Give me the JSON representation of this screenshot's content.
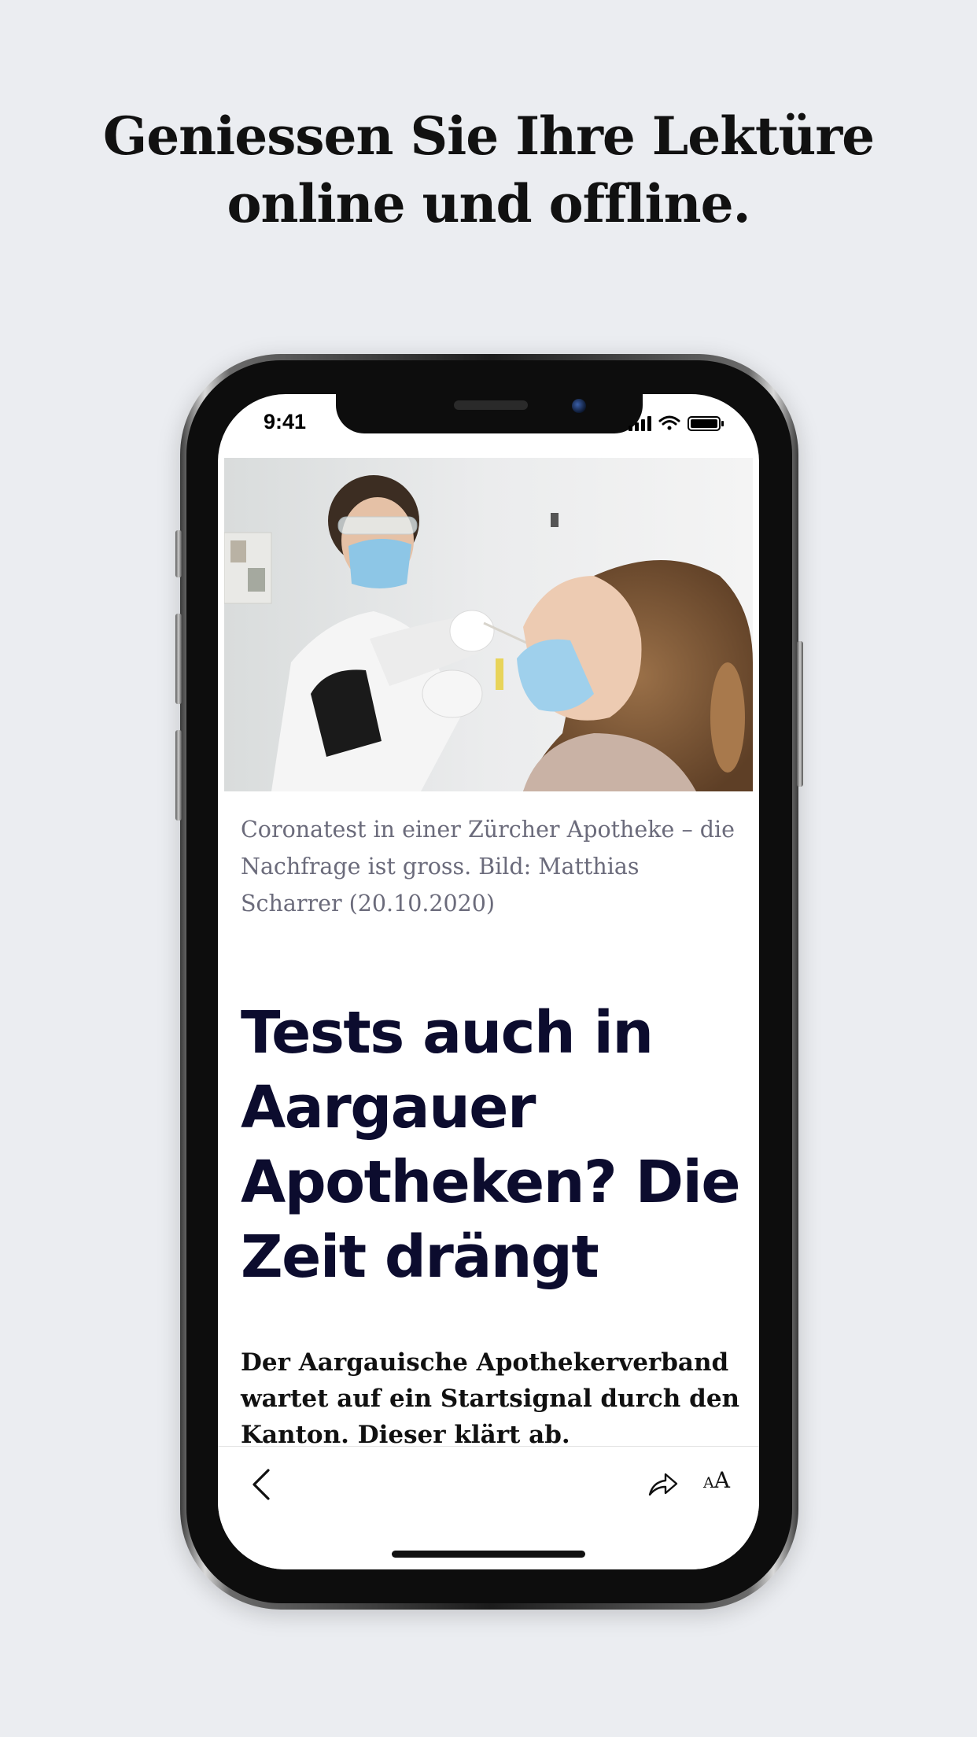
{
  "promo": {
    "headline_line1": "Geniessen Sie Ihre Lektüre",
    "headline_line2": "online und offline."
  },
  "status_bar": {
    "time": "9:41",
    "icons": [
      "signal-icon",
      "wifi-icon",
      "battery-icon"
    ]
  },
  "article": {
    "image_description_icon": "photo",
    "caption": "Coronatest in einer Zürcher Apotheke – die Nachfrage ist gross. Bild: Matthias Scharrer (20.10.2020)",
    "title": "Tests auch in Aargauer Apotheken? Die Zeit drängt",
    "lead": "Der Aargauische Apothekerverband wartet auf ein Startsignal durch den Kanton. Dieser klärt ab."
  },
  "toolbar": {
    "back_icon": "chevron-left-icon",
    "share_icon": "share-icon",
    "font_size_small": "A",
    "font_size_big": "A"
  },
  "colors": {
    "background": "#ebedf1",
    "title": "#0c0c2e",
    "caption": "#6b6b7b"
  }
}
